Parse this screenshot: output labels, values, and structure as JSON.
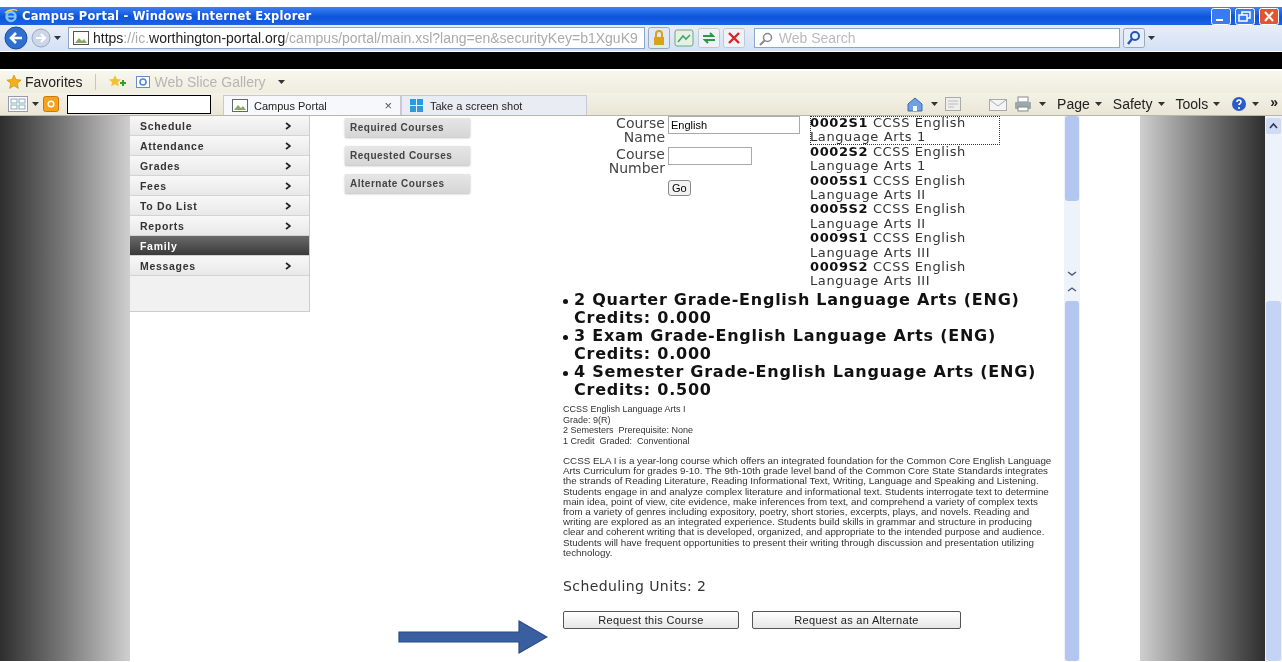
{
  "window": {
    "title": "Campus Portal - Windows Internet Explorer"
  },
  "address_bar": {
    "scheme": "https",
    "host_prefix": "://ic.",
    "domain": "worthington-portal.org",
    "path": "/campus/portal/main.xsl?lang=en&securityKey=b1XguK9"
  },
  "search": {
    "placeholder": "Web Search"
  },
  "favorites_bar": {
    "label": "Favorites",
    "items": [
      {
        "label": "Web Slice Gallery"
      }
    ]
  },
  "tabs": [
    {
      "label": "Campus Portal",
      "selected": true,
      "close": "×"
    },
    {
      "label": "Take a screen shot",
      "selected": false
    }
  ],
  "command_bar": {
    "menus": [
      "Page",
      "Safety",
      "Tools"
    ],
    "overflow": "»"
  },
  "sidebar": {
    "items": [
      {
        "label": "Schedule",
        "selected": false,
        "submenu": true
      },
      {
        "label": "Attendance",
        "selected": false,
        "submenu": true
      },
      {
        "label": "Grades",
        "selected": false,
        "submenu": true
      },
      {
        "label": "Fees",
        "selected": false,
        "submenu": true
      },
      {
        "label": "To Do List",
        "selected": false,
        "submenu": true
      },
      {
        "label": "Reports",
        "selected": false,
        "submenu": true
      },
      {
        "label": "Family",
        "selected": true,
        "submenu": false
      },
      {
        "label": "Messages",
        "selected": false,
        "submenu": true
      }
    ]
  },
  "course_list_buttons": [
    "Required Courses",
    "Requested Courses",
    "Alternate Courses"
  ],
  "search_form": {
    "fields": [
      {
        "label": "Course Name",
        "value": "English"
      },
      {
        "label": "Course Number"
      }
    ],
    "go_button": "Go"
  },
  "course_list": [
    {
      "code": "0002S1",
      "title": "CCSS English Language Arts 1",
      "selected": true
    },
    {
      "code": "0002S2",
      "title": "CCSS English Language Arts 1",
      "selected": false
    },
    {
      "code": "0005S1",
      "title": "CCSS English Language Arts II",
      "selected": false
    },
    {
      "code": "0005S2",
      "title": "CCSS English Language Arts II",
      "selected": false
    },
    {
      "code": "0009S1",
      "title": "CCSS English Language Arts III",
      "selected": false
    },
    {
      "code": "0009S2",
      "title": "CCSS English Language Arts III",
      "selected": false
    }
  ],
  "grading_tasks": [
    "2 Quarter Grade-English Language Arts (ENG) Credits: 0.000",
    "3 Exam Grade-English Language Arts (ENG) Credits: 0.000",
    "4 Semester Grade-English Language Arts (ENG) Credits: 0.500"
  ],
  "course_info": {
    "lines": [
      "CCSS English Language Arts I",
      "Grade: 9(R)",
      "2 Semesters  Prerequisite: None",
      "1 Credit  Graded:  Conventional"
    ],
    "description": "CCSS ELA I is a year-long course which offers an integrated foundation for the Common Core English Language Arts Curriculum for grades 9-10.  The 9th-10th grade level band of the Common Core State Standards integrates the strands of Reading Literature, Reading Informational Text, Writing, Language and Speaking and Listening.  Students engage in and analyze complex literature and informational text.  Students interrogate text to determine main idea, point of view, cite evidence, make inferences from text, and comprehend a variety of complex texts from a variety of genres including expository, poetry, short stories, excerpts, plays, and novels.  Reading and writing are explored as an integrated experience.  Students build skills in grammar and structure in producing clear and coherent writing that is developed, organized, and appropriate to the intended purpose and audience.  Students will have frequent opportunities to present their writing through discussion and presentation utilizing technology."
  },
  "scheduling_units": "Scheduling Units: 2",
  "actions": [
    "Request this Course",
    "Request as an Alternate"
  ]
}
